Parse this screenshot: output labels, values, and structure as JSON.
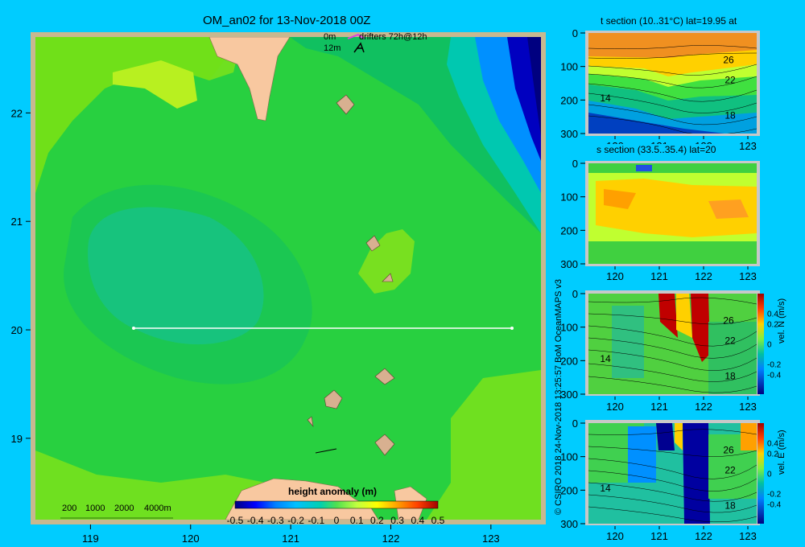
{
  "title": "OM_an02 for 13-Nov-2018 00Z",
  "drifter_legend": {
    "line1": "0m",
    "line1_label": "drifters 72h@12h",
    "line2": "12m"
  },
  "depth_legend": [
    "200",
    "1000",
    "2000",
    "4000m"
  ],
  "colorbar": {
    "label": "height anomaly (m)",
    "ticks": [
      "-0.5",
      "-0.4",
      "-0.3",
      "-0.2",
      "-0.1",
      "0",
      "0.1",
      "0.2",
      "0.3",
      "0.4",
      "0.5"
    ]
  },
  "credit": "© CSIRO 2018   24-Nov-2018 13:25:57 BoM OceanMAPS v3",
  "colors": {
    "background": "#00ccff",
    "land": "#f8c8a0",
    "section_line": "#ffffff"
  },
  "chart_data": [
    {
      "type": "heatmap",
      "title": "OM_an02 for 13-Nov-2018 00Z",
      "variable": "height anomaly (m)",
      "x_ticks": [
        "119",
        "120",
        "121",
        "122",
        "123"
      ],
      "y_ticks": [
        "22",
        "21",
        "20",
        "19"
      ],
      "xlim": [
        118.45,
        123.5
      ],
      "ylim": [
        18.25,
        22.7
      ],
      "colorbar_range": [
        -0.5,
        0.5
      ],
      "section_line": {
        "lat": 20,
        "lon_start": 119.5,
        "lon_end": 123.2
      }
    },
    {
      "type": "heatmap",
      "title": "t section (10..31°C) lat=19.95 at",
      "x_ticks": [
        "120",
        "121",
        "122",
        "123"
      ],
      "y_ticks": [
        "0",
        "100",
        "200",
        "300"
      ],
      "ylim": [
        300,
        0
      ],
      "contour_labels": [
        "26",
        "22",
        "14",
        "18"
      ]
    },
    {
      "type": "heatmap",
      "title": "s section (33.5..35.4) lat=20",
      "x_ticks": [
        "120",
        "121",
        "122",
        "123"
      ],
      "y_ticks": [
        "0",
        "100",
        "200",
        "300"
      ],
      "ylim": [
        300,
        0
      ]
    },
    {
      "type": "heatmap",
      "title": "vel. N (m/s)",
      "x_ticks": [
        "120",
        "121",
        "122",
        "123"
      ],
      "y_ticks": [
        "0",
        "100",
        "200",
        "300"
      ],
      "ylim": [
        300,
        0
      ],
      "colorbar_ticks": [
        "0.4",
        "0.2",
        "0",
        "-0.2",
        "-0.4"
      ],
      "contour_labels": [
        "26",
        "22",
        "14",
        "18"
      ]
    },
    {
      "type": "heatmap",
      "title": "vel. E (m/s)",
      "x_ticks": [
        "120",
        "121",
        "122",
        "123"
      ],
      "y_ticks": [
        "0",
        "100",
        "200",
        "300"
      ],
      "ylim": [
        300,
        0
      ],
      "colorbar_ticks": [
        "0.4",
        "0.2",
        "0",
        "-0.2",
        "-0.4"
      ],
      "contour_labels": [
        "26",
        "22",
        "14",
        "18"
      ]
    }
  ]
}
